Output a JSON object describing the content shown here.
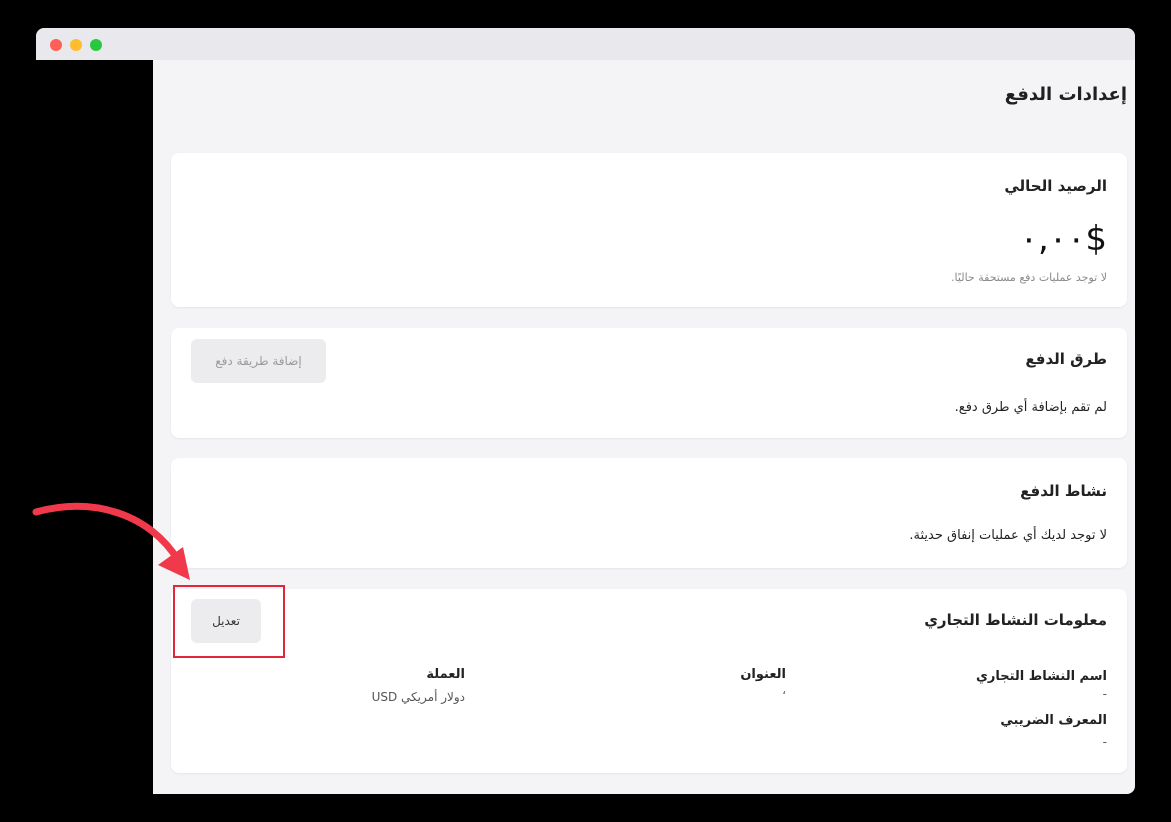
{
  "page": {
    "title": "إعدادات الدفع"
  },
  "balance": {
    "title": "الرصيد الحالي",
    "amount": "٠,٠٠$",
    "note": "لا توجد عمليات دفع مستحقة حاليًا."
  },
  "payment_methods": {
    "title": "طرق الدفع",
    "add_button": "إضافة طريقة دفع",
    "empty_text": "لم تقم بإضافة أي طرق دفع."
  },
  "payment_activity": {
    "title": "نشاط الدفع",
    "empty_text": "لا توجد لديك أي عمليات إنفاق حديثة."
  },
  "business_info": {
    "title": "معلومات النشاط التجاري",
    "edit_button": "تعديل",
    "business_name_label": "اسم النشاط التجاري",
    "business_name_value": "-",
    "address_label": "العنوان",
    "address_value": "،",
    "currency_label": "العملة",
    "currency_value": "دولار أمريكي USD",
    "tax_id_label": "المعرف الضريبي",
    "tax_id_value": "-"
  },
  "colors": {
    "highlight": "#e3273a",
    "window_bg": "#f4f3f6"
  }
}
